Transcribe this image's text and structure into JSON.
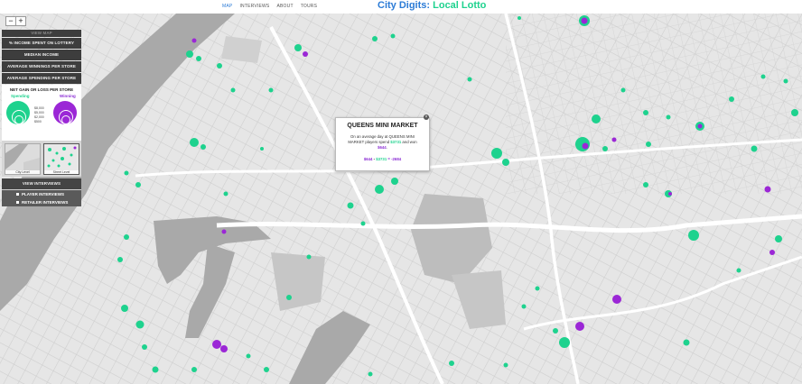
{
  "nav": {
    "items": [
      "MAP",
      "INTERVIEWS",
      "ABOUT",
      "TOURS"
    ]
  },
  "site": {
    "title_main": "City Digits: ",
    "title_accent": "Local Lotto"
  },
  "zoom": {
    "in_label": "+",
    "out_label": "−"
  },
  "panel": {
    "top_label": "VIEW MAP",
    "layers": [
      "% INCOME SPENT ON LOTTERY",
      "MEDIAN INCOME",
      "AVERAGE WINNINGS PER STORE",
      "AVERAGE SPENDING PER STORE"
    ],
    "legend": {
      "title": "NET GAIN OR LOSS PER STORE",
      "spending_label": "Spending",
      "winning_label": "Winning",
      "values": [
        "$8,000",
        "$5,000",
        "$2,000",
        "$500"
      ]
    },
    "levels": [
      "City Level",
      "Street Level"
    ],
    "view_interviews": "VIEW INTERVIEWS",
    "interview_items": [
      "PLAYER INTERVIEWS",
      "RETAILER INTERVIEWS"
    ]
  },
  "popup": {
    "title": "QUEENS MINI MARKET",
    "line1": "On an average day at QUEENS MINI",
    "line2_a": "MARKET players spend ",
    "line2_spend": "$3731",
    "line2_b": " and won",
    "line3_win": "$644",
    "line3_end": ".",
    "calc_win": "$644",
    "calc_mid": " - ",
    "calc_spend": "$3731",
    "calc_end": " = -2684"
  },
  "colors": {
    "spending": "#1ed28e",
    "winning": "#9b27d6",
    "accent": "#2b7bd6"
  }
}
